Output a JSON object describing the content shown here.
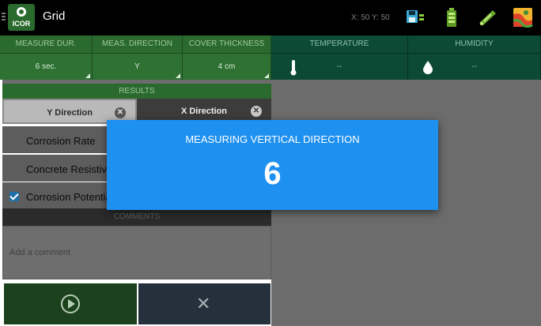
{
  "app": {
    "logo_text": "ICOR",
    "title": "Grid",
    "coords": "X: 50 Y: 50"
  },
  "toolbar_icons": [
    "grid-save-icon",
    "battery-icon",
    "wifi-icon",
    "map-icon"
  ],
  "settings": [
    {
      "header": "MEASURE DUR.",
      "value": "6 sec."
    },
    {
      "header": "MEAS. DIRECTION",
      "value": "Y"
    },
    {
      "header": "COVER THICKNESS",
      "value": "4 cm"
    }
  ],
  "environment": [
    {
      "header": "TEMPERATURE",
      "value": "--",
      "icon": "thermometer-icon"
    },
    {
      "header": "HUMIDITY",
      "value": "--",
      "icon": "droplet-icon"
    }
  ],
  "results": {
    "header": "RESULTS",
    "tabs": [
      {
        "label": "Y Direction"
      },
      {
        "label": "X Direction"
      }
    ],
    "options": [
      {
        "label": "Corrosion Rate",
        "checked": false
      },
      {
        "label": "Concrete Resistivity",
        "checked": false
      },
      {
        "label": "Corrosion Potential",
        "checked": true
      }
    ]
  },
  "comments": {
    "header": "COMMENTS",
    "placeholder": "Add a comment"
  },
  "actions": {
    "start_icon": "play-circle-icon",
    "cancel_icon": "close-icon"
  },
  "dialog": {
    "title": "MEASURING VERTICAL DIRECTION",
    "countdown": "6"
  },
  "colors": {
    "primary_green": "#2b6a2e",
    "env_teal": "#0d4a36",
    "dialog_blue": "#1e90f0"
  }
}
